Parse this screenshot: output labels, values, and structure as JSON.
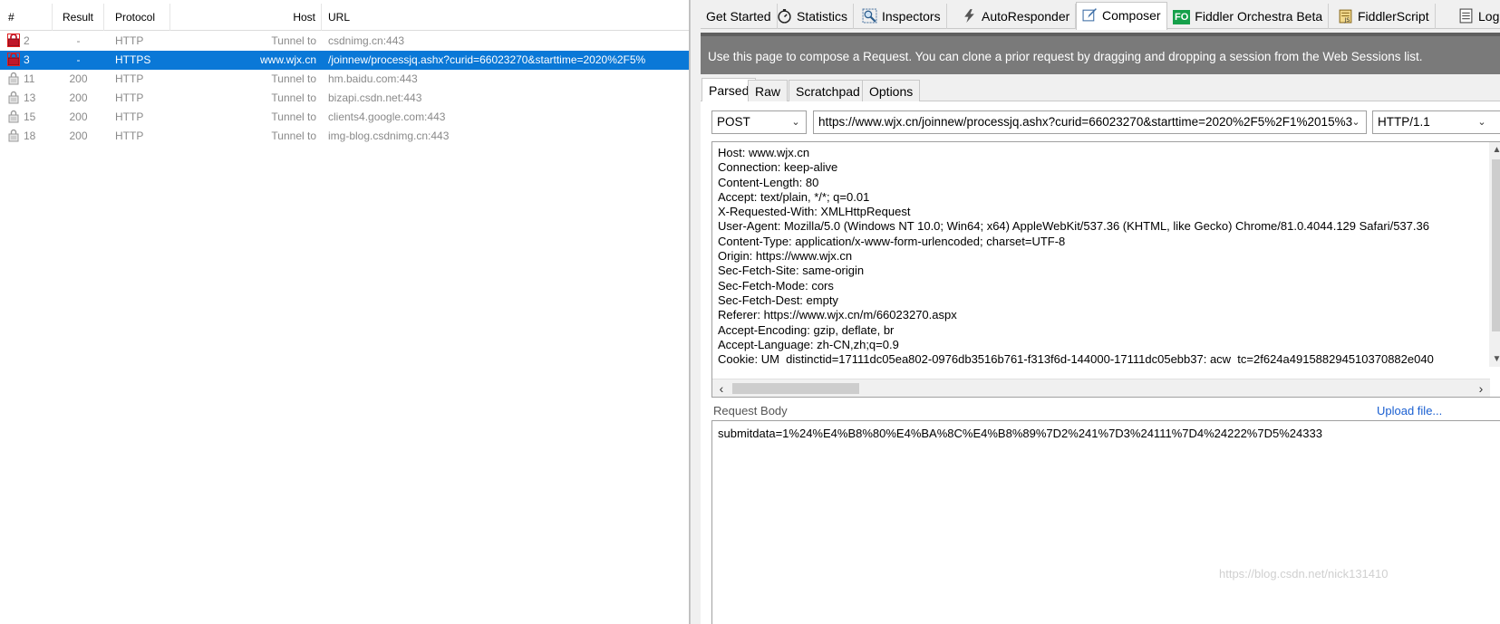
{
  "sessions": {
    "columns": {
      "num": "#",
      "result": "Result",
      "protocol": "Protocol",
      "host": "Host",
      "url": "URL"
    },
    "rows": [
      {
        "num": "2",
        "result": "-",
        "protocol": "HTTP",
        "host": "Tunnel to",
        "url": "csdnimg.cn:443",
        "icon": "lock-icon-red",
        "selected": false
      },
      {
        "num": "3",
        "result": "-",
        "protocol": "HTTPS",
        "host": "www.wjx.cn",
        "url": "/joinnew/processjq.ashx?curid=66023270&starttime=2020%2F5%",
        "icon": "lock-icon-red",
        "selected": true
      },
      {
        "num": "11",
        "result": "200",
        "protocol": "HTTP",
        "host": "Tunnel to",
        "url": "hm.baidu.com:443",
        "icon": "lock-icon",
        "selected": false
      },
      {
        "num": "13",
        "result": "200",
        "protocol": "HTTP",
        "host": "Tunnel to",
        "url": "bizapi.csdn.net:443",
        "icon": "lock-icon",
        "selected": false
      },
      {
        "num": "15",
        "result": "200",
        "protocol": "HTTP",
        "host": "Tunnel to",
        "url": "clients4.google.com:443",
        "icon": "lock-icon",
        "selected": false
      },
      {
        "num": "18",
        "result": "200",
        "protocol": "HTTP",
        "host": "Tunnel to",
        "url": "img-blog.csdnimg.cn:443",
        "icon": "lock-icon",
        "selected": false
      }
    ]
  },
  "tabs": {
    "get_started": "Get Started",
    "statistics": "Statistics",
    "inspectors": "Inspectors",
    "autoresponder": "AutoResponder",
    "composer": "Composer",
    "orchestra": "Fiddler Orchestra Beta",
    "orchestra_badge": "FO",
    "fiddlerscript": "FiddlerScript",
    "log": "Log"
  },
  "composer": {
    "info": "Use this page to compose a Request. You can clone a prior request by dragging and dropping a session from the Web Sessions list.",
    "subtabs": {
      "parsed": "Parsed",
      "raw": "Raw",
      "scratchpad": "Scratchpad",
      "options": "Options"
    },
    "method": "POST",
    "url": "https://www.wjx.cn/joinnew/processjq.ashx?curid=66023270&starttime=2020%2F5%2F1%2015%3",
    "http_version": "HTTP/1.1",
    "headers": "Host: www.wjx.cn\nConnection: keep-alive\nContent-Length: 80\nAccept: text/plain, */*; q=0.01\nX-Requested-With: XMLHttpRequest\nUser-Agent: Mozilla/5.0 (Windows NT 10.0; Win64; x64) AppleWebKit/537.36 (KHTML, like Gecko) Chrome/81.0.4044.129 Safari/537.36\nContent-Type: application/x-www-form-urlencoded; charset=UTF-8\nOrigin: https://www.wjx.cn\nSec-Fetch-Site: same-origin\nSec-Fetch-Mode: cors\nSec-Fetch-Dest: empty\nReferer: https://www.wjx.cn/m/66023270.aspx\nAccept-Encoding: gzip, deflate, br\nAccept-Language: zh-CN,zh;q=0.9\nCookie: UM_distinctid=17111dc05ea802-0976db3516b761-f313f6d-144000-17111dc05ebb37; acw_tc=2f624a491588294510370882e040",
    "request_body_label": "Request Body",
    "upload_link": "Upload file...",
    "request_body": "submitdata=1%24%E4%B8%80%E4%BA%8C%E4%B8%89%7D2%241%7D3%24111%7D4%24222%7D5%24333"
  },
  "watermark": "https://blog.csdn.net/nick131410",
  "colors": {
    "selection": "#0a78d7",
    "info_bar": "#7a7a7a",
    "link": "#1a5fd1"
  }
}
